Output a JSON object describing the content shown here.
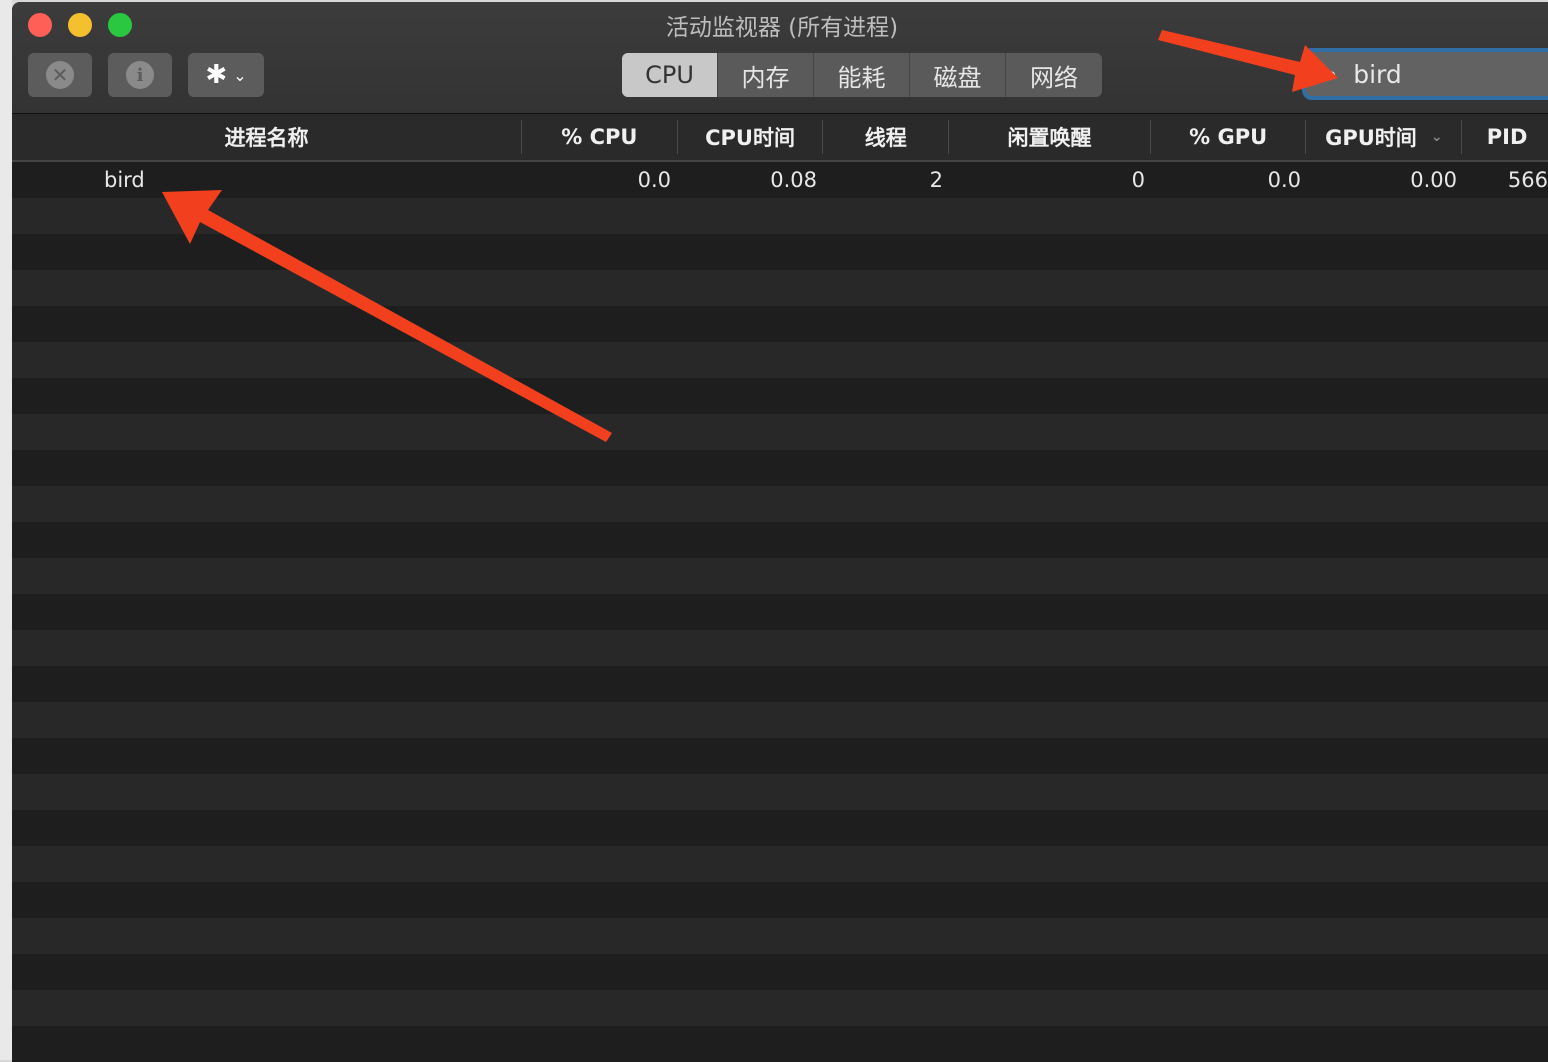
{
  "window": {
    "title": "活动监视器 (所有进程)"
  },
  "toolbar": {
    "stop_icon": "x-octagon-icon",
    "info_icon": "info-icon",
    "gear_icon": "gear-icon"
  },
  "tabs": [
    {
      "label": "CPU",
      "active": true
    },
    {
      "label": "内存"
    },
    {
      "label": "能耗"
    },
    {
      "label": "磁盘"
    },
    {
      "label": "网络"
    }
  ],
  "search": {
    "value": "bird"
  },
  "columns": [
    "进程名称",
    "% CPU",
    "CPU时间",
    "线程",
    "闲置唤醒",
    "% GPU",
    "GPU时间",
    "PID"
  ],
  "rows": [
    [
      "bird",
      "0.0",
      "0.08",
      "2",
      "0",
      "0.0",
      "0.00",
      "566"
    ]
  ],
  "colors": {
    "annotation_arrow": "#f2401f",
    "search_focus": "#2f6fa6"
  }
}
